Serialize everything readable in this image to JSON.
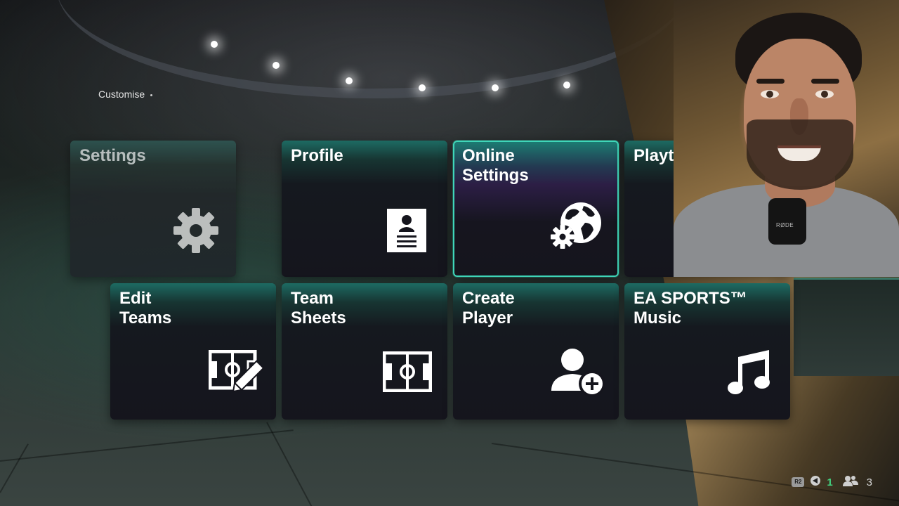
{
  "breadcrumb": {
    "label": "Customise"
  },
  "tiles": [
    {
      "title": "Settings",
      "icon": "gear-icon"
    },
    {
      "title": "Profile",
      "icon": "profile-card-icon"
    },
    {
      "title": "Online\nSettings",
      "icon": "globe-gear-icon"
    },
    {
      "title": "Playtime",
      "icon": ""
    },
    {
      "title": "Edit\nTeams",
      "icon": "pitch-edit-icon"
    },
    {
      "title": "Team\nSheets",
      "icon": "pitch-icon"
    },
    {
      "title": "Create\nPlayer",
      "icon": "add-person-icon"
    },
    {
      "title": "EA SPORTS™\nMusic",
      "icon": "music-note-icon"
    }
  ],
  "status_bar": {
    "r2_label": "R2",
    "notifications_count": "1",
    "friends_count": "3"
  },
  "webcam": {
    "mic_label": "RØDE"
  },
  "colors": {
    "focus": "#3fd6b9",
    "tile_bg": "#15151d",
    "tile_accent": "#1d6b63",
    "online_green": "#43d17f"
  }
}
